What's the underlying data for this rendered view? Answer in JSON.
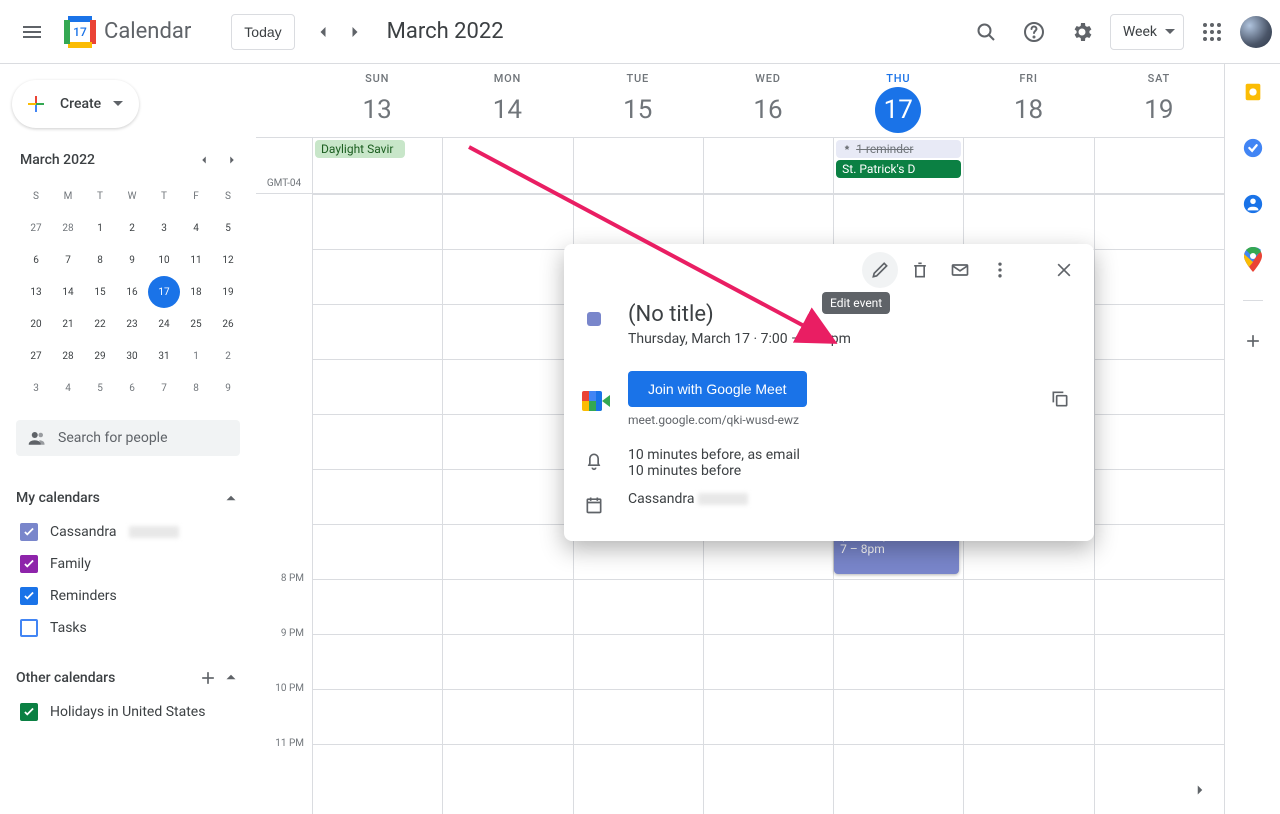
{
  "header": {
    "logo_day": "17",
    "app_name": "Calendar",
    "today_label": "Today",
    "month_title": "March 2022",
    "view_label": "Week"
  },
  "sidebar": {
    "create_label": "Create",
    "mini_title": "March 2022",
    "dow": [
      "S",
      "M",
      "T",
      "W",
      "T",
      "F",
      "S"
    ],
    "weeks": [
      [
        {
          "n": 27,
          "dim": true
        },
        {
          "n": 28,
          "dim": true
        },
        {
          "n": 1
        },
        {
          "n": 2
        },
        {
          "n": 3
        },
        {
          "n": 4
        },
        {
          "n": 5
        }
      ],
      [
        {
          "n": 6
        },
        {
          "n": 7
        },
        {
          "n": 8
        },
        {
          "n": 9
        },
        {
          "n": 10
        },
        {
          "n": 11
        },
        {
          "n": 12
        }
      ],
      [
        {
          "n": 13
        },
        {
          "n": 14
        },
        {
          "n": 15
        },
        {
          "n": 16
        },
        {
          "n": 17,
          "today": true
        },
        {
          "n": 18
        },
        {
          "n": 19
        }
      ],
      [
        {
          "n": 20
        },
        {
          "n": 21
        },
        {
          "n": 22
        },
        {
          "n": 23
        },
        {
          "n": 24
        },
        {
          "n": 25
        },
        {
          "n": 26
        }
      ],
      [
        {
          "n": 27
        },
        {
          "n": 28
        },
        {
          "n": 29
        },
        {
          "n": 30
        },
        {
          "n": 31
        },
        {
          "n": 1,
          "dim": true
        },
        {
          "n": 2,
          "dim": true
        }
      ],
      [
        {
          "n": 3,
          "dim": true
        },
        {
          "n": 4,
          "dim": true
        },
        {
          "n": 5,
          "dim": true
        },
        {
          "n": 6,
          "dim": true
        },
        {
          "n": 7,
          "dim": true
        },
        {
          "n": 8,
          "dim": true
        },
        {
          "n": 9,
          "dim": true
        }
      ]
    ],
    "search_placeholder": "Search for people",
    "my_cal_title": "My calendars",
    "my_calendars": [
      {
        "label": "Cassandra",
        "color": "#7986cb",
        "checked": true,
        "redact": true
      },
      {
        "label": "Family",
        "color": "#8e24aa",
        "checked": true
      },
      {
        "label": "Reminders",
        "color": "#1a73e8",
        "checked": true
      },
      {
        "label": "Tasks",
        "color": "#4285f4",
        "checked": false
      }
    ],
    "other_cal_title": "Other calendars",
    "other_calendars": [
      {
        "label": "Holidays in United States",
        "color": "#0b8043",
        "checked": true
      }
    ]
  },
  "week": {
    "tz": "GMT-04",
    "days": [
      {
        "dow": "SUN",
        "num": 13
      },
      {
        "dow": "MON",
        "num": 14
      },
      {
        "dow": "TUE",
        "num": 15
      },
      {
        "dow": "WED",
        "num": 16
      },
      {
        "dow": "THU",
        "num": 17,
        "today": true
      },
      {
        "dow": "FRI",
        "num": 18
      },
      {
        "dow": "SAT",
        "num": 19
      }
    ],
    "allday": {
      "dst_label": "Daylight Savir",
      "reminder_label": "1 reminder",
      "stpat_label": "St. Patrick's D"
    },
    "time_labels": [
      "8 PM",
      "9 PM",
      "10 PM",
      "11 PM"
    ],
    "event": {
      "title": "(No title)",
      "time": "7 – 8pm"
    }
  },
  "popup": {
    "tooltip": "Edit event",
    "title": "(No title)",
    "date_time": "Thursday, March 17  ·  7:00 – 8:00pm",
    "meet_btn": "Join with Google Meet",
    "meet_link": "meet.google.com/qki-wusd-ewz",
    "reminder1": "10 minutes before, as email",
    "reminder2": "10 minutes before",
    "owner": "Cassandra"
  }
}
